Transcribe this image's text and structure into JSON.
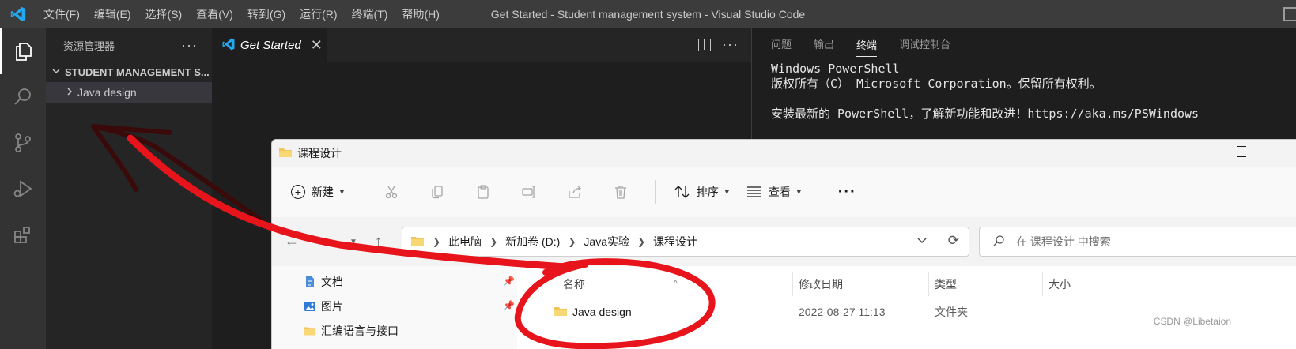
{
  "titlebar": {
    "menu": [
      "文件(F)",
      "编辑(E)",
      "选择(S)",
      "查看(V)",
      "转到(G)",
      "运行(R)",
      "终端(T)",
      "帮助(H)"
    ],
    "window_title": "Get Started - Student management system - Visual Studio Code"
  },
  "activitybar": {
    "items": [
      "explorer-icon",
      "search-icon",
      "source-control-icon",
      "run-debug-icon",
      "extensions-icon"
    ]
  },
  "sidebar": {
    "title": "资源管理器",
    "more": "···",
    "folder": "STUDENT MANAGEMENT S...",
    "items": [
      {
        "label": "Java design"
      }
    ]
  },
  "editor": {
    "tab_label": "Get Started",
    "tab_close": "✕",
    "more": "···"
  },
  "panel": {
    "tabs": [
      "问题",
      "输出",
      "终端",
      "调试控制台"
    ],
    "active_tab": "终端",
    "terminal_lines": [
      "Windows PowerShell",
      "版权所有（C） Microsoft Corporation。保留所有权利。",
      "",
      "安装最新的 PowerShell，了解新功能和改进！https://aka.ms/PSWindows"
    ]
  },
  "file_explorer": {
    "window_title": "课程设计",
    "toolbar": {
      "new_label": "新建",
      "sort_label": "排序",
      "view_label": "查看",
      "more": "···"
    },
    "breadcrumb": [
      "此电脑",
      "新加卷 (D:)",
      "Java实验",
      "课程设计"
    ],
    "search_placeholder": "在 课程设计 中搜索",
    "nav_items": [
      {
        "label": "文档",
        "icon": "document-icon"
      },
      {
        "label": "图片",
        "icon": "picture-icon"
      },
      {
        "label": "汇编语言与接口",
        "icon": "folder-icon"
      }
    ],
    "columns": [
      "名称",
      "修改日期",
      "类型",
      "大小"
    ],
    "rows": [
      {
        "name": "Java design",
        "modified": "2022-08-27 11:13",
        "type": "文件夹",
        "size": ""
      }
    ]
  },
  "watermark": "CSDN @Libetaion",
  "colors": {
    "vscode_blue": "#23a9f2",
    "annotation_red": "#e8141c",
    "annotation_dark": "#3a0a0a"
  }
}
